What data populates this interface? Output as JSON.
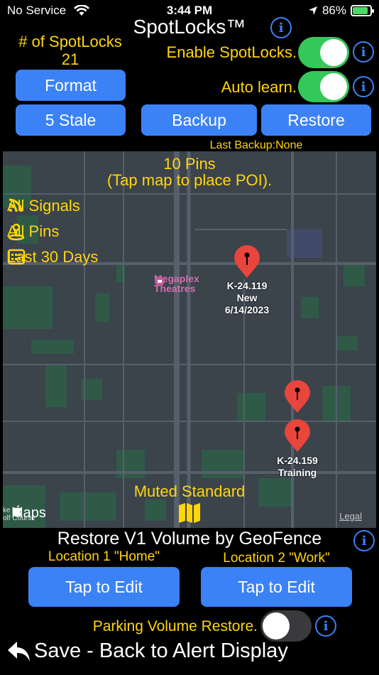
{
  "status_bar": {
    "carrier": "No Service",
    "time": "3:44 PM",
    "battery": "86%"
  },
  "header": {
    "title": "SpotLocks™"
  },
  "spotlocks": {
    "count_label": "# of SpotLocks",
    "count": "21"
  },
  "settings": {
    "enable_label": "Enable SpotLocks.",
    "enable_on": true,
    "auto_learn_label": "Auto learn.",
    "auto_learn_on": true
  },
  "buttons": {
    "format": "Format",
    "stale": "5 Stale",
    "backup": "Backup",
    "restore": "Restore"
  },
  "last_backup": "Last Backup:None",
  "map": {
    "pins_count": "10 Pins",
    "hint": "(Tap map to place POI).",
    "filters": [
      {
        "icon": "signal-icon",
        "label": "All Signals"
      },
      {
        "icon": "pin-filter-icon",
        "label": "All Pins"
      },
      {
        "icon": "calendar-icon",
        "label": "Last 30 Days"
      }
    ],
    "poi": "Megaplex Theatres",
    "pins": [
      {
        "label_1": "K-24.119",
        "label_2": "New",
        "label_3": "6/14/2023"
      },
      {
        "label_1": "",
        "label_2": "",
        "label_3": ""
      },
      {
        "label_1": "K-24.159",
        "label_2": "Training",
        "label_3": ""
      }
    ],
    "style_label": "Muted Standard",
    "brand": "Maps",
    "legal": "Legal",
    "edge_text": "ke\nolf Course"
  },
  "geofence": {
    "title": "Restore V1 Volume by GeoFence",
    "location1_label": "Location 1 \"Home\"",
    "location2_label": "Location 2 \"Work\"",
    "edit1": "Tap to Edit",
    "edit2": "Tap to Edit"
  },
  "parking": {
    "label": "Parking Volume Restore.",
    "on": false
  },
  "footer": {
    "save_label": "Save - Back to Alert Display"
  },
  "colors": {
    "accent": "#3b82f6",
    "yellow": "#ffd60a",
    "toggle_on": "#34c759",
    "pin": "#e8453c"
  }
}
